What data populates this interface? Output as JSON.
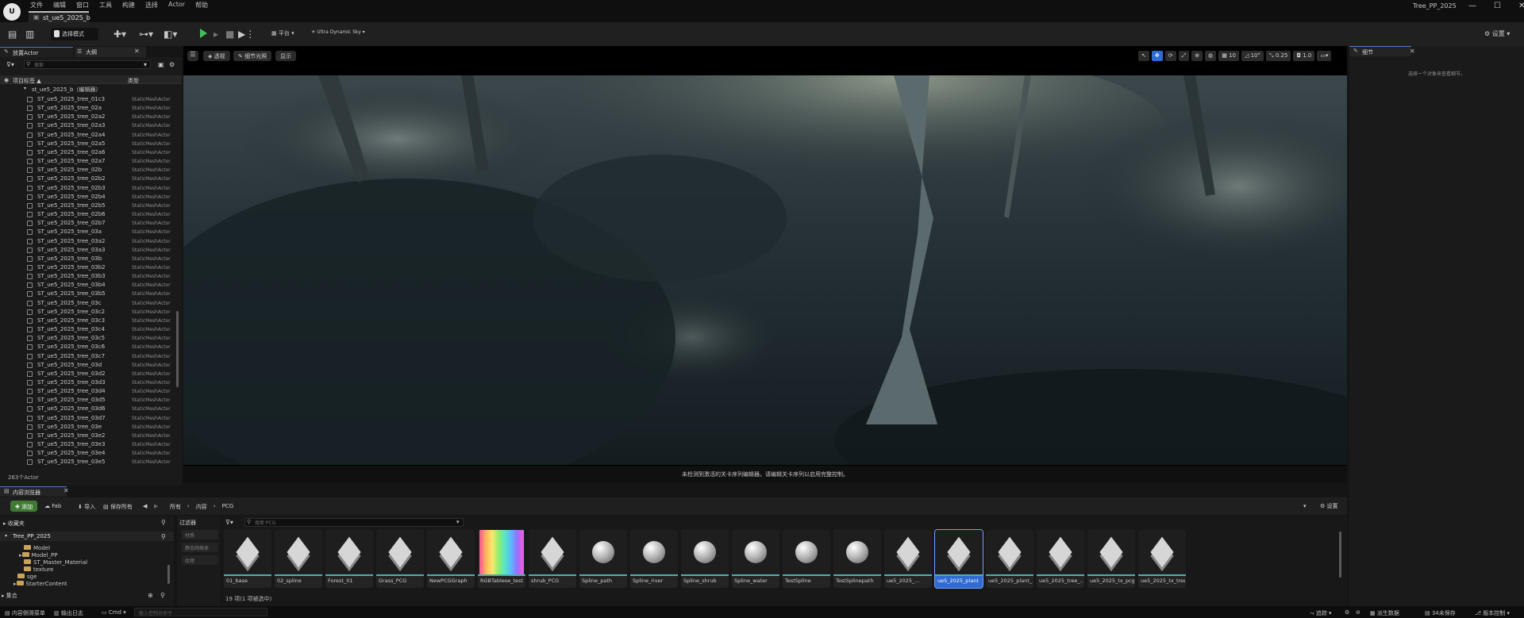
{
  "titlebar": {
    "menus": [
      "文件",
      "编辑",
      "窗口",
      "工具",
      "构建",
      "选择",
      "Actor",
      "帮助"
    ],
    "doc_tab": "st_ue5_2025_b",
    "app_title": "Tree_PP_2025",
    "window_controls": [
      "—",
      "☐",
      "✕"
    ]
  },
  "toolbar": {
    "mode": "选择模式",
    "platform": "平台",
    "sky": "Ultra Dynamic Sky",
    "settings": "设置"
  },
  "left_panel": {
    "tab_place": "放置Actor",
    "tab_outline": "大纲",
    "search_placeholder": "搜索",
    "col_label": "项目标签 ▲",
    "col_type": "类型",
    "editor_row": "st_ue5_2025_b（编辑器）",
    "actor_type": "StaticMeshActor",
    "actors": [
      "ST_ue5_2025_tree_01c3",
      "ST_ue5_2025_tree_02a",
      "ST_ue5_2025_tree_02a2",
      "ST_ue5_2025_tree_02a3",
      "ST_ue5_2025_tree_02a4",
      "ST_ue5_2025_tree_02a5",
      "ST_ue5_2025_tree_02a6",
      "ST_ue5_2025_tree_02a7",
      "ST_ue5_2025_tree_02b",
      "ST_ue5_2025_tree_02b2",
      "ST_ue5_2025_tree_02b3",
      "ST_ue5_2025_tree_02b4",
      "ST_ue5_2025_tree_02b5",
      "ST_ue5_2025_tree_02b6",
      "ST_ue5_2025_tree_02b7",
      "ST_ue5_2025_tree_03a",
      "ST_ue5_2025_tree_03a2",
      "ST_ue5_2025_tree_03a3",
      "ST_ue5_2025_tree_03b",
      "ST_ue5_2025_tree_03b2",
      "ST_ue5_2025_tree_03b3",
      "ST_ue5_2025_tree_03b4",
      "ST_ue5_2025_tree_03b5",
      "ST_ue5_2025_tree_03c",
      "ST_ue5_2025_tree_03c2",
      "ST_ue5_2025_tree_03c3",
      "ST_ue5_2025_tree_03c4",
      "ST_ue5_2025_tree_03c5",
      "ST_ue5_2025_tree_03c6",
      "ST_ue5_2025_tree_03c7",
      "ST_ue5_2025_tree_03d",
      "ST_ue5_2025_tree_03d2",
      "ST_ue5_2025_tree_03d3",
      "ST_ue5_2025_tree_03d4",
      "ST_ue5_2025_tree_03d5",
      "ST_ue5_2025_tree_03d6",
      "ST_ue5_2025_tree_03d7",
      "ST_ue5_2025_tree_03e",
      "ST_ue5_2025_tree_03e2",
      "ST_ue5_2025_tree_03e3",
      "ST_ue5_2025_tree_03e4",
      "ST_ue5_2025_tree_03e5"
    ],
    "count": "263个Actor"
  },
  "viewport": {
    "btn_perspective": "透视",
    "btn_lit": "细节光照",
    "btn_show": "显示",
    "right_tools": [
      "10",
      "10°",
      "0.25",
      "1.0"
    ],
    "message": "未检测到激活的关卡序列编辑器。请编辑关卡序列以启用完整控制。"
  },
  "details": {
    "tab": "细节",
    "empty": "选择一个对象来查看细节。"
  },
  "content_browser": {
    "tab": "内容浏览器",
    "add": "添加",
    "fab": "Fab",
    "import": "导入",
    "save_all": "保存所有",
    "breadcrumbs": [
      "所有",
      "内容",
      "PCG"
    ],
    "settings": "设置",
    "favorites": "收藏夹",
    "project": "Tree_PP_2025",
    "folders": [
      "Model",
      "Model_PP",
      "ST_Master_Material",
      "texture",
      "sge",
      "StarterContent"
    ],
    "collections": "集合",
    "filters_title": "过滤器",
    "filters": [
      "材质",
      "静态网格体",
      "纹理"
    ],
    "search_placeholder": "搜索 PCG",
    "assets": [
      {
        "label": "01_base",
        "kind": "cube"
      },
      {
        "label": "02_spline",
        "kind": "cube"
      },
      {
        "label": "Forest_01",
        "kind": "cube"
      },
      {
        "label": "Grass_PCG",
        "kind": "cube"
      },
      {
        "label": "NewPCGGraph",
        "kind": "cube"
      },
      {
        "label": "RGBTablese_test",
        "kind": "tex"
      },
      {
        "label": "shrub_PCG",
        "kind": "cube"
      },
      {
        "label": "Spline_path",
        "kind": "sphere"
      },
      {
        "label": "Spline_river",
        "kind": "sphere"
      },
      {
        "label": "Spline_shrub",
        "kind": "sphere"
      },
      {
        "label": "Spline_water",
        "kind": "sphere"
      },
      {
        "label": "TestSpline",
        "kind": "sphere"
      },
      {
        "label": "TestSplinepath",
        "kind": "sphere"
      },
      {
        "label": "ue5_2025_...",
        "kind": "cube"
      },
      {
        "label": "ue5_2025_plant",
        "kind": "cube",
        "selected": true
      },
      {
        "label": "ue5_2025_plant_...",
        "kind": "cube"
      },
      {
        "label": "ue5_2025_tree_...",
        "kind": "cube"
      },
      {
        "label": "ue5_2025_tx_pcg",
        "kind": "cube"
      },
      {
        "label": "ue5_2025_tx_tree",
        "kind": "cube"
      }
    ],
    "item_count": "19 项(1 项被选中)"
  },
  "statusbar": {
    "drawer": "内容侧滑菜单",
    "output_log": "输出日志",
    "cmd": "Cmd",
    "cmd_placeholder": "输入控制台命令",
    "trace": "追踪",
    "derived_data": "派生数据",
    "unsaved": "34未保存",
    "source_control": "版本控制"
  },
  "colors": {
    "accent": "#2f6bd1",
    "play": "#3fc25b",
    "add": "#3d7a32"
  }
}
